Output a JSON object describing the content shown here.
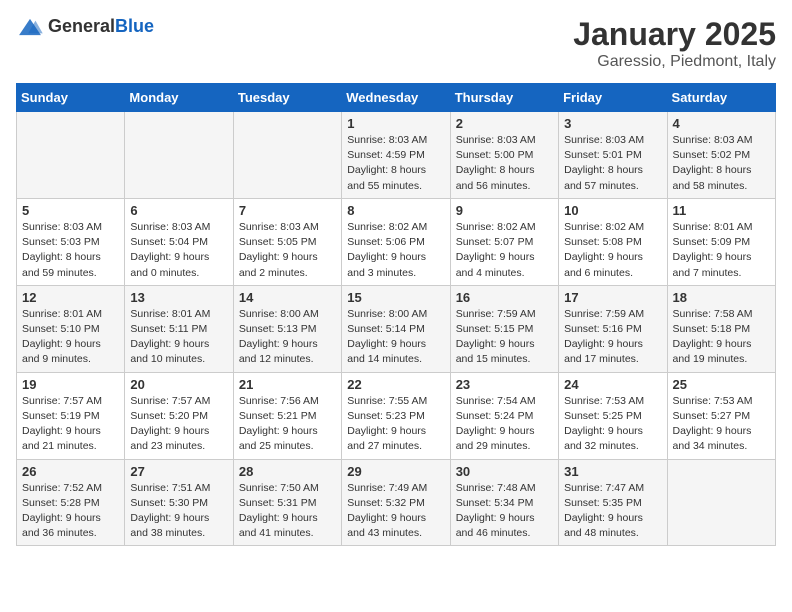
{
  "header": {
    "logo_general": "General",
    "logo_blue": "Blue",
    "title": "January 2025",
    "subtitle": "Garessio, Piedmont, Italy"
  },
  "days_of_week": [
    "Sunday",
    "Monday",
    "Tuesday",
    "Wednesday",
    "Thursday",
    "Friday",
    "Saturday"
  ],
  "weeks": [
    [
      {
        "day": "",
        "info": ""
      },
      {
        "day": "",
        "info": ""
      },
      {
        "day": "",
        "info": ""
      },
      {
        "day": "1",
        "info": "Sunrise: 8:03 AM\nSunset: 4:59 PM\nDaylight: 8 hours\nand 55 minutes."
      },
      {
        "day": "2",
        "info": "Sunrise: 8:03 AM\nSunset: 5:00 PM\nDaylight: 8 hours\nand 56 minutes."
      },
      {
        "day": "3",
        "info": "Sunrise: 8:03 AM\nSunset: 5:01 PM\nDaylight: 8 hours\nand 57 minutes."
      },
      {
        "day": "4",
        "info": "Sunrise: 8:03 AM\nSunset: 5:02 PM\nDaylight: 8 hours\nand 58 minutes."
      }
    ],
    [
      {
        "day": "5",
        "info": "Sunrise: 8:03 AM\nSunset: 5:03 PM\nDaylight: 8 hours\nand 59 minutes."
      },
      {
        "day": "6",
        "info": "Sunrise: 8:03 AM\nSunset: 5:04 PM\nDaylight: 9 hours\nand 0 minutes."
      },
      {
        "day": "7",
        "info": "Sunrise: 8:03 AM\nSunset: 5:05 PM\nDaylight: 9 hours\nand 2 minutes."
      },
      {
        "day": "8",
        "info": "Sunrise: 8:02 AM\nSunset: 5:06 PM\nDaylight: 9 hours\nand 3 minutes."
      },
      {
        "day": "9",
        "info": "Sunrise: 8:02 AM\nSunset: 5:07 PM\nDaylight: 9 hours\nand 4 minutes."
      },
      {
        "day": "10",
        "info": "Sunrise: 8:02 AM\nSunset: 5:08 PM\nDaylight: 9 hours\nand 6 minutes."
      },
      {
        "day": "11",
        "info": "Sunrise: 8:01 AM\nSunset: 5:09 PM\nDaylight: 9 hours\nand 7 minutes."
      }
    ],
    [
      {
        "day": "12",
        "info": "Sunrise: 8:01 AM\nSunset: 5:10 PM\nDaylight: 9 hours\nand 9 minutes."
      },
      {
        "day": "13",
        "info": "Sunrise: 8:01 AM\nSunset: 5:11 PM\nDaylight: 9 hours\nand 10 minutes."
      },
      {
        "day": "14",
        "info": "Sunrise: 8:00 AM\nSunset: 5:13 PM\nDaylight: 9 hours\nand 12 minutes."
      },
      {
        "day": "15",
        "info": "Sunrise: 8:00 AM\nSunset: 5:14 PM\nDaylight: 9 hours\nand 14 minutes."
      },
      {
        "day": "16",
        "info": "Sunrise: 7:59 AM\nSunset: 5:15 PM\nDaylight: 9 hours\nand 15 minutes."
      },
      {
        "day": "17",
        "info": "Sunrise: 7:59 AM\nSunset: 5:16 PM\nDaylight: 9 hours\nand 17 minutes."
      },
      {
        "day": "18",
        "info": "Sunrise: 7:58 AM\nSunset: 5:18 PM\nDaylight: 9 hours\nand 19 minutes."
      }
    ],
    [
      {
        "day": "19",
        "info": "Sunrise: 7:57 AM\nSunset: 5:19 PM\nDaylight: 9 hours\nand 21 minutes."
      },
      {
        "day": "20",
        "info": "Sunrise: 7:57 AM\nSunset: 5:20 PM\nDaylight: 9 hours\nand 23 minutes."
      },
      {
        "day": "21",
        "info": "Sunrise: 7:56 AM\nSunset: 5:21 PM\nDaylight: 9 hours\nand 25 minutes."
      },
      {
        "day": "22",
        "info": "Sunrise: 7:55 AM\nSunset: 5:23 PM\nDaylight: 9 hours\nand 27 minutes."
      },
      {
        "day": "23",
        "info": "Sunrise: 7:54 AM\nSunset: 5:24 PM\nDaylight: 9 hours\nand 29 minutes."
      },
      {
        "day": "24",
        "info": "Sunrise: 7:53 AM\nSunset: 5:25 PM\nDaylight: 9 hours\nand 32 minutes."
      },
      {
        "day": "25",
        "info": "Sunrise: 7:53 AM\nSunset: 5:27 PM\nDaylight: 9 hours\nand 34 minutes."
      }
    ],
    [
      {
        "day": "26",
        "info": "Sunrise: 7:52 AM\nSunset: 5:28 PM\nDaylight: 9 hours\nand 36 minutes."
      },
      {
        "day": "27",
        "info": "Sunrise: 7:51 AM\nSunset: 5:30 PM\nDaylight: 9 hours\nand 38 minutes."
      },
      {
        "day": "28",
        "info": "Sunrise: 7:50 AM\nSunset: 5:31 PM\nDaylight: 9 hours\nand 41 minutes."
      },
      {
        "day": "29",
        "info": "Sunrise: 7:49 AM\nSunset: 5:32 PM\nDaylight: 9 hours\nand 43 minutes."
      },
      {
        "day": "30",
        "info": "Sunrise: 7:48 AM\nSunset: 5:34 PM\nDaylight: 9 hours\nand 46 minutes."
      },
      {
        "day": "31",
        "info": "Sunrise: 7:47 AM\nSunset: 5:35 PM\nDaylight: 9 hours\nand 48 minutes."
      },
      {
        "day": "",
        "info": ""
      }
    ]
  ]
}
